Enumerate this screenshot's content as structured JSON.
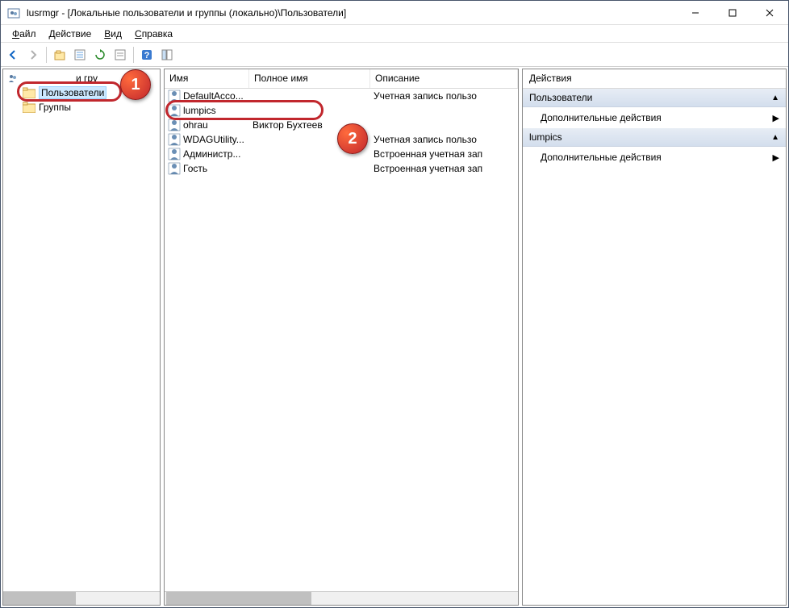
{
  "window": {
    "title": "lusrmgr - [Локальные пользователи и группы (локально)\\Пользователи]"
  },
  "menu": {
    "file": "Файл",
    "action": "Действие",
    "view": "Вид",
    "help": "Справка"
  },
  "tree": {
    "root": "Локальные пользователи и группы",
    "root_short": "и гру",
    "users": "Пользователи",
    "groups": "Группы"
  },
  "columns": {
    "name": "Имя",
    "fullname": "Полное имя",
    "description": "Описание"
  },
  "users": [
    {
      "name": "DefaultAcco...",
      "fullname": "",
      "desc": "Учетная запись пользо"
    },
    {
      "name": "lumpics",
      "fullname": "",
      "desc": ""
    },
    {
      "name": "ohrau",
      "fullname": "Виктор Бухтеев",
      "desc": ""
    },
    {
      "name": "WDAGUtility...",
      "fullname": "",
      "desc": "Учетная запись пользо"
    },
    {
      "name": "Администр...",
      "fullname": "",
      "desc": "Встроенная учетная зап"
    },
    {
      "name": "Гость",
      "fullname": "",
      "desc": "Встроенная учетная зап"
    }
  ],
  "actions": {
    "title": "Действия",
    "section1": "Пользователи",
    "more1": "Дополнительные действия",
    "section2": "lumpics",
    "more2": "Дополнительные действия"
  },
  "badges": {
    "one": "1",
    "two": "2"
  }
}
